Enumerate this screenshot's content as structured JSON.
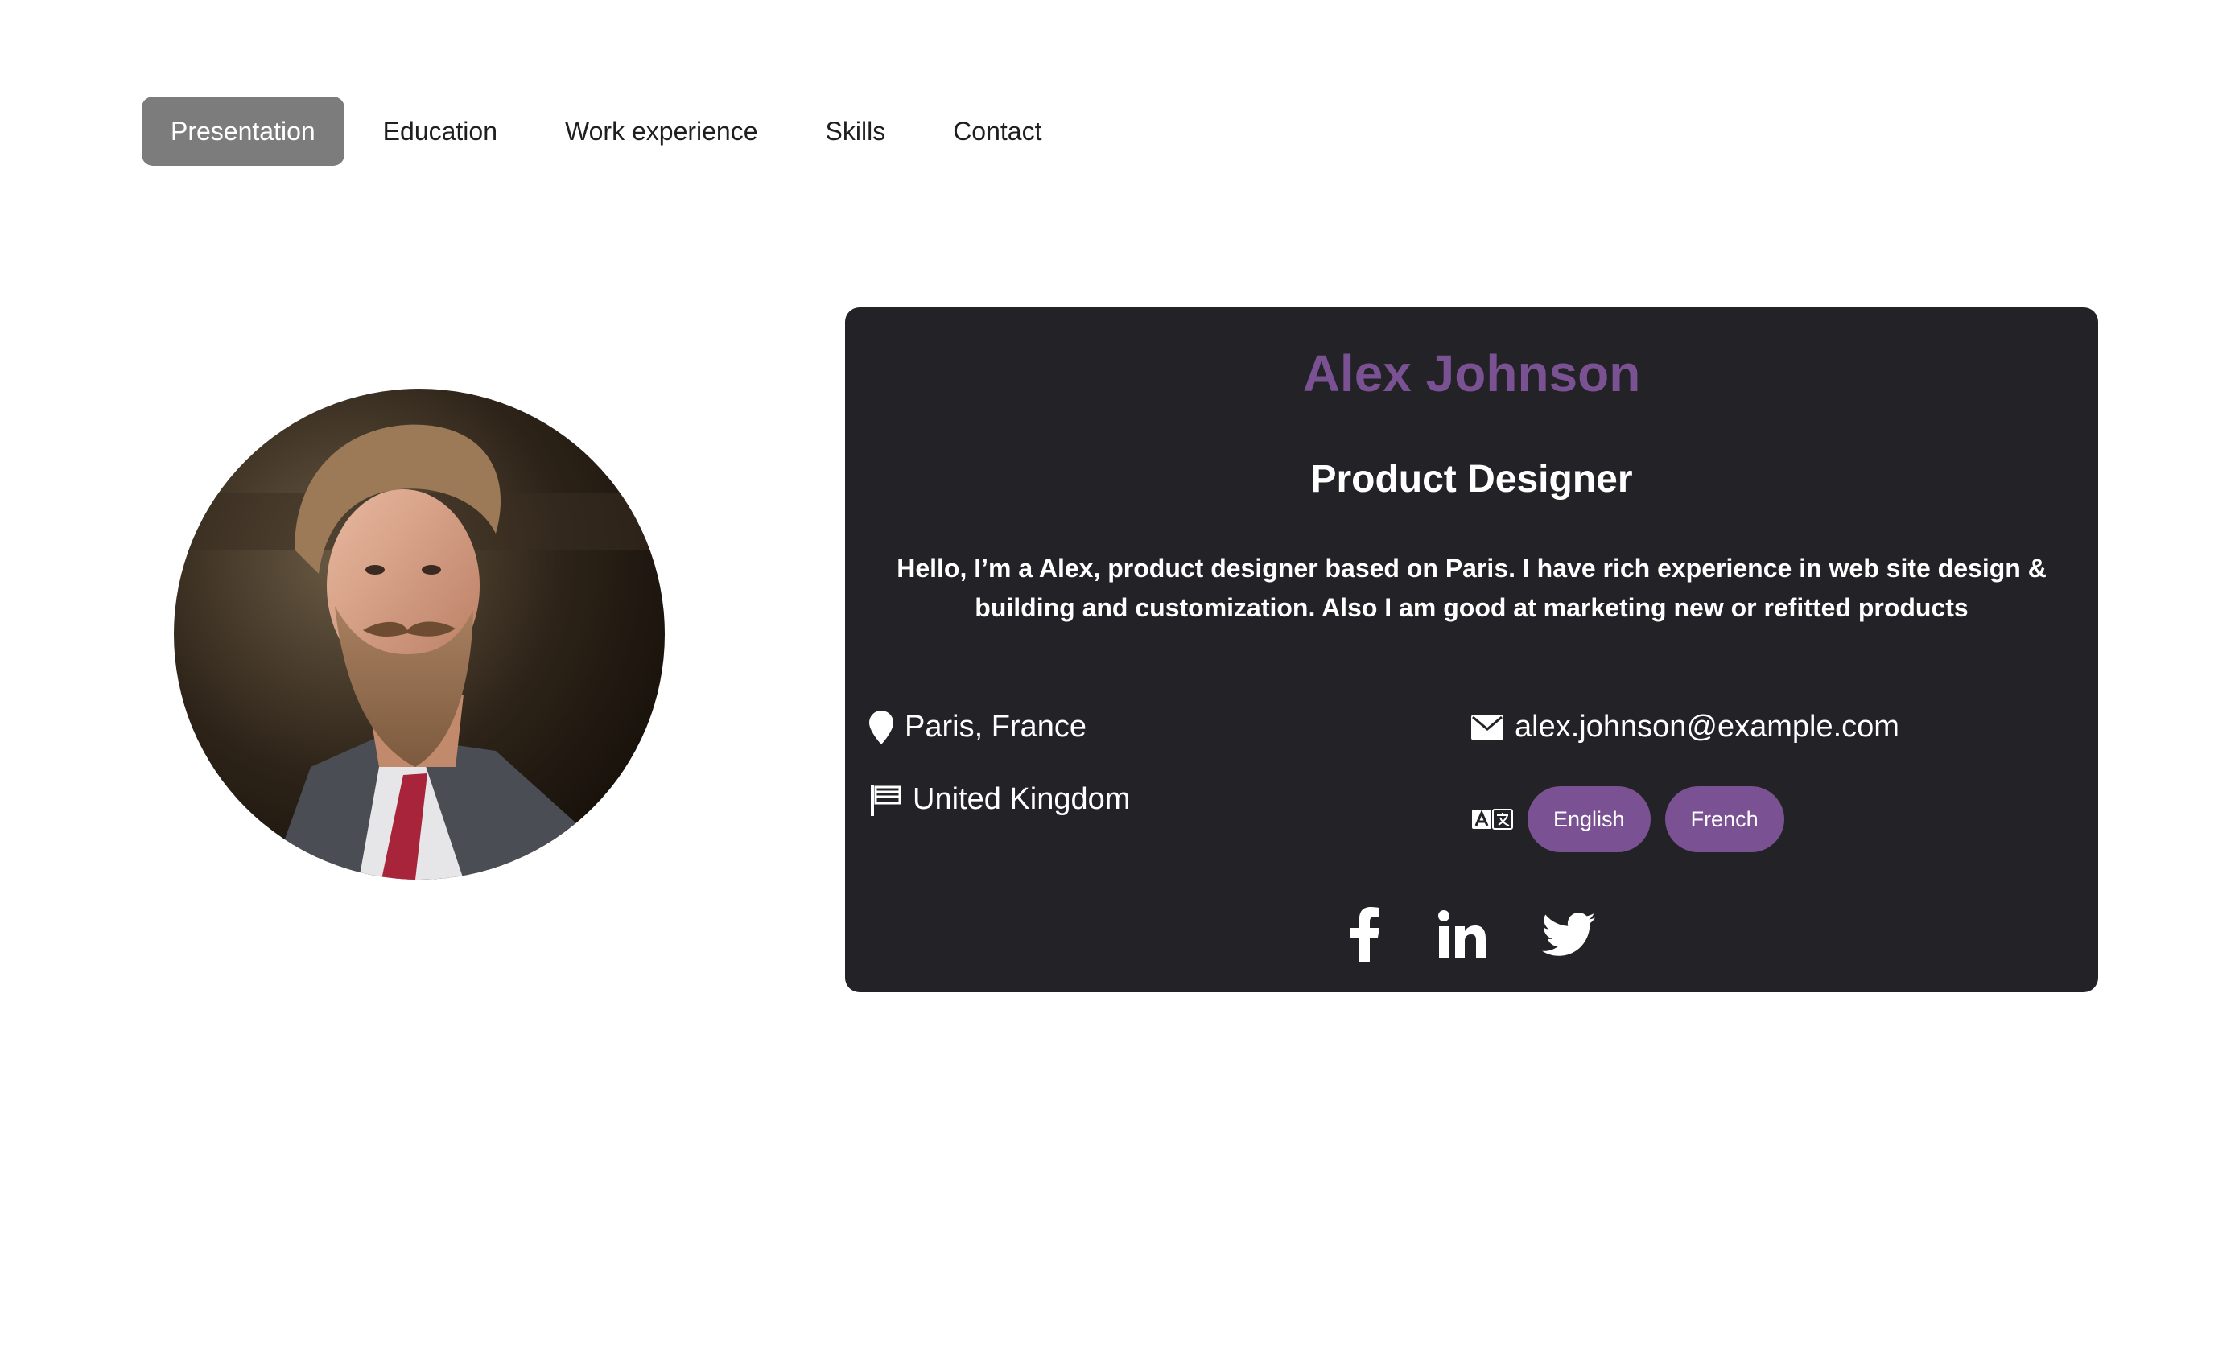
{
  "nav": {
    "tabs": [
      {
        "label": "Presentation",
        "active": true
      },
      {
        "label": "Education",
        "active": false
      },
      {
        "label": "Work experience",
        "active": false
      },
      {
        "label": "Skills",
        "active": false
      },
      {
        "label": "Contact",
        "active": false
      }
    ]
  },
  "profile": {
    "name": "Alex Johnson",
    "role": "Product Designer",
    "bio": "Hello, I’m a Alex, product designer based on Paris. I have rich experience in web site design & building and customization. Also I am good at marketing new or refitted products",
    "location": "Paris, France",
    "country": "United Kingdom",
    "email": "alex.johnson@example.com",
    "languages": [
      "English",
      "French"
    ]
  },
  "icons": {
    "location": "map-pin-icon",
    "country": "flag-icon",
    "email": "envelope-icon",
    "languages": "translate-icon",
    "socials": [
      "facebook-icon",
      "linkedin-icon",
      "twitter-icon"
    ]
  },
  "colors": {
    "accent": "#7a5192",
    "card_bg": "#232227",
    "active_tab_bg": "#7c7c7c"
  }
}
